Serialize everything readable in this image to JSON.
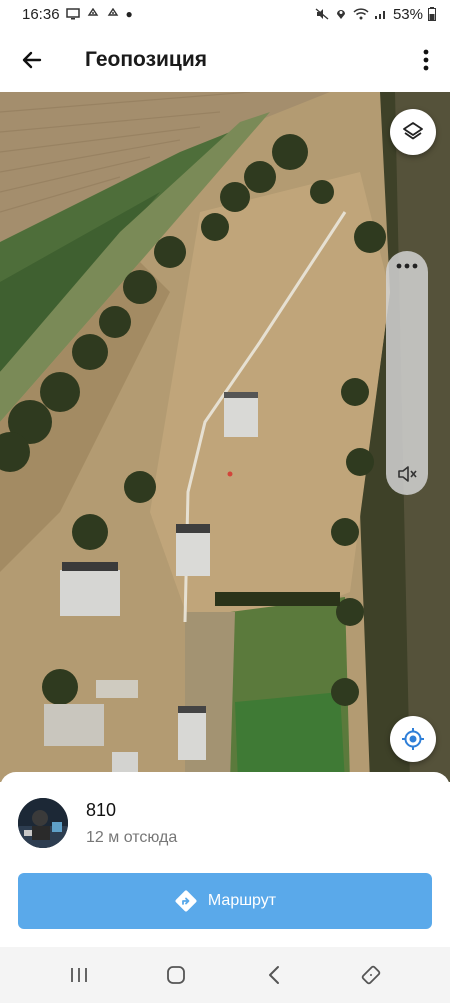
{
  "status_bar": {
    "time": "16:36",
    "battery": "53%",
    "left_icons": [
      "monitor-icon",
      "recycle-icon",
      "recycle-icon",
      "dot-icon"
    ],
    "right_icons": [
      "mute-icon",
      "location-icon",
      "wifi-icon",
      "signal-icon",
      "battery-icon"
    ]
  },
  "app_bar": {
    "title": "Геопозиция",
    "back_icon": "arrow-left-icon",
    "menu_icon": "more-vert-icon"
  },
  "map": {
    "layers_icon": "layers-icon",
    "locate_icon": "my-location-icon",
    "panel_icons": [
      "more-horiz-icon",
      "volume-off-icon"
    ]
  },
  "contact": {
    "name": "810",
    "distance": "12 м отсюда"
  },
  "route_button": {
    "label": "Маршрут",
    "icon": "directions-icon",
    "color": "#5aa9ea"
  },
  "nav_bar": {
    "icons": [
      "recents-icon",
      "home-icon",
      "back-icon",
      "rotate-icon"
    ]
  }
}
